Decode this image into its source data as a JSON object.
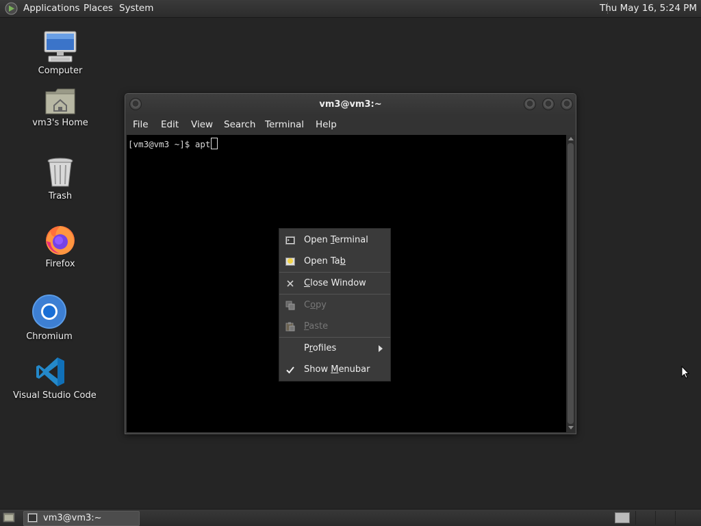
{
  "top_panel": {
    "menus": [
      "Applications",
      "Places",
      "System"
    ],
    "clock": "Thu May 16,  5:24 PM"
  },
  "desktop": {
    "icons": [
      {
        "label": "Computer",
        "icon": "computer-icon"
      },
      {
        "label": "vm3's Home",
        "icon": "home-folder-icon"
      },
      {
        "label": "Trash",
        "icon": "trash-icon"
      },
      {
        "label": "Firefox",
        "icon": "firefox-icon"
      },
      {
        "label": "Chromium",
        "icon": "chromium-icon"
      },
      {
        "label": "Visual Studio Code",
        "icon": "vscode-icon"
      }
    ]
  },
  "terminal": {
    "title": "vm3@vm3:~",
    "menus": [
      "File",
      "Edit",
      "View",
      "Search",
      "Terminal",
      "Help"
    ],
    "prompt": "[vm3@vm3 ~]$ apt"
  },
  "context_menu": {
    "items": [
      {
        "pre": "Open ",
        "ul": "T",
        "post": "erminal",
        "icon": "terminal-icon",
        "enabled": true
      },
      {
        "pre": "Open Ta",
        "ul": "b",
        "post": "",
        "icon": "new-tab-icon",
        "enabled": true
      },
      {
        "pre": "",
        "ul": "C",
        "post": "lose Window",
        "icon": "close-icon",
        "enabled": true
      },
      {
        "pre": "C",
        "ul": "o",
        "post": "py",
        "icon": "copy-icon",
        "enabled": false
      },
      {
        "pre": "",
        "ul": "P",
        "post": "aste",
        "icon": "paste-icon",
        "enabled": false
      },
      {
        "pre": "P",
        "ul": "r",
        "post": "ofiles",
        "icon": "submenu-arrow-icon",
        "enabled": true
      },
      {
        "pre": "Show ",
        "ul": "M",
        "post": "enubar",
        "icon": "checkmark-icon",
        "enabled": true,
        "checked": true
      }
    ]
  },
  "taskbar": {
    "window_button": "vm3@vm3:~"
  },
  "colors": {
    "desktop_bg": "#252525",
    "panel_bg": "#333333",
    "terminal_bg": "#000000",
    "menu_bg": "#3a3a3a"
  }
}
